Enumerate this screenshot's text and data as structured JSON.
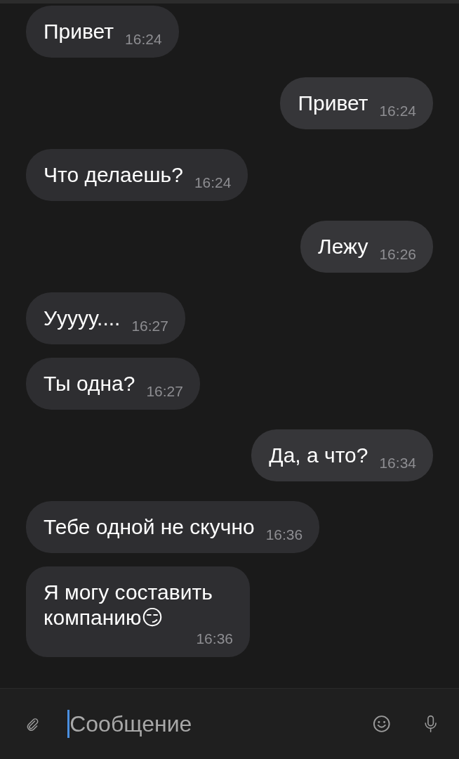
{
  "messages": [
    {
      "text": "Привет",
      "time": "16:24",
      "outgoing": false,
      "time_below": false
    },
    {
      "text": "Привет",
      "time": "16:24",
      "outgoing": true,
      "time_below": false
    },
    {
      "text": "Что делаешь?",
      "time": "16:24",
      "outgoing": false,
      "time_below": false
    },
    {
      "text": "Лежу",
      "time": "16:26",
      "outgoing": true,
      "time_below": false
    },
    {
      "text": "Ууууу....",
      "time": "16:27",
      "outgoing": false,
      "time_below": false
    },
    {
      "text": "Ты одна?",
      "time": "16:27",
      "outgoing": false,
      "time_below": false
    },
    {
      "text": "Да, а что?",
      "time": "16:34",
      "outgoing": true,
      "time_below": false
    },
    {
      "text": "Тебе одной не скучно",
      "time": "16:36",
      "outgoing": false,
      "time_below": false
    },
    {
      "text": "Я могу составить компанию😏",
      "time": "16:36",
      "outgoing": false,
      "time_below": true
    }
  ],
  "composer": {
    "placeholder": "Сообщение",
    "focused": true
  }
}
